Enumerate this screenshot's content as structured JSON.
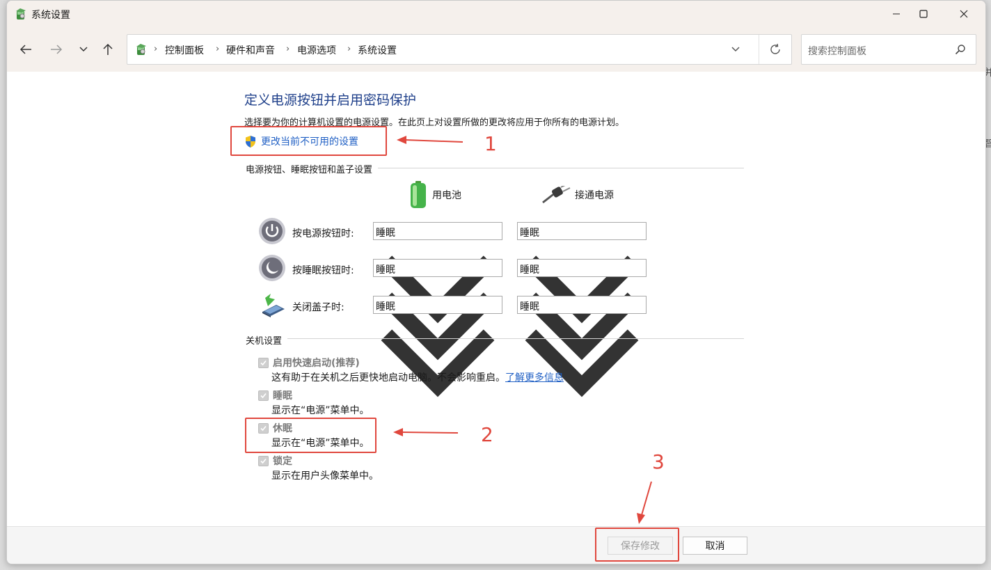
{
  "window": {
    "title": "系统设置"
  },
  "nav": {
    "breadcrumbs": [
      "控制面板",
      "硬件和声音",
      "电源选项",
      "系统设置"
    ],
    "search_placeholder": "搜索控制面板"
  },
  "page": {
    "heading": "定义电源按钮并启用密码保护",
    "description": "选择要为你的计算机设置的电源设置。在此页上对设置所做的更改将应用于你所有的电源计划。",
    "change_settings_link": "更改当前不可用的设置"
  },
  "power_buttons": {
    "section_title": "电源按钮、睡眠按钮和盖子设置",
    "battery_label": "用电池",
    "plugged_label": "接通电源",
    "rows": [
      {
        "label": "按电源按钮时:",
        "battery": "睡眠",
        "plugged": "睡眠"
      },
      {
        "label": "按睡眠按钮时:",
        "battery": "睡眠",
        "plugged": "睡眠"
      },
      {
        "label": "关闭盖子时:",
        "battery": "睡眠",
        "plugged": "睡眠"
      }
    ]
  },
  "shutdown": {
    "section_title": "关机设置",
    "options": [
      {
        "label": "启用快速启动(推荐)",
        "desc": "这有助于在关机之后更快地启动电脑。不会影响重启。",
        "link": "了解更多信息",
        "checked": true
      },
      {
        "label": "睡眠",
        "desc": "显示在“电源”菜单中。",
        "checked": true
      },
      {
        "label": "休眠",
        "desc": "显示在“电源”菜单中。",
        "checked": true
      },
      {
        "label": "锁定",
        "desc": "显示在用户头像菜单中。",
        "checked": true
      }
    ]
  },
  "footer": {
    "save_label": "保存修改",
    "cancel_label": "取消"
  },
  "annotations": [
    "1",
    "2",
    "3"
  ],
  "colors": {
    "annotation": "#e0473d",
    "heading": "#1e3f8a",
    "link": "#1f5fc4",
    "chrome": "#f5f0ec"
  }
}
